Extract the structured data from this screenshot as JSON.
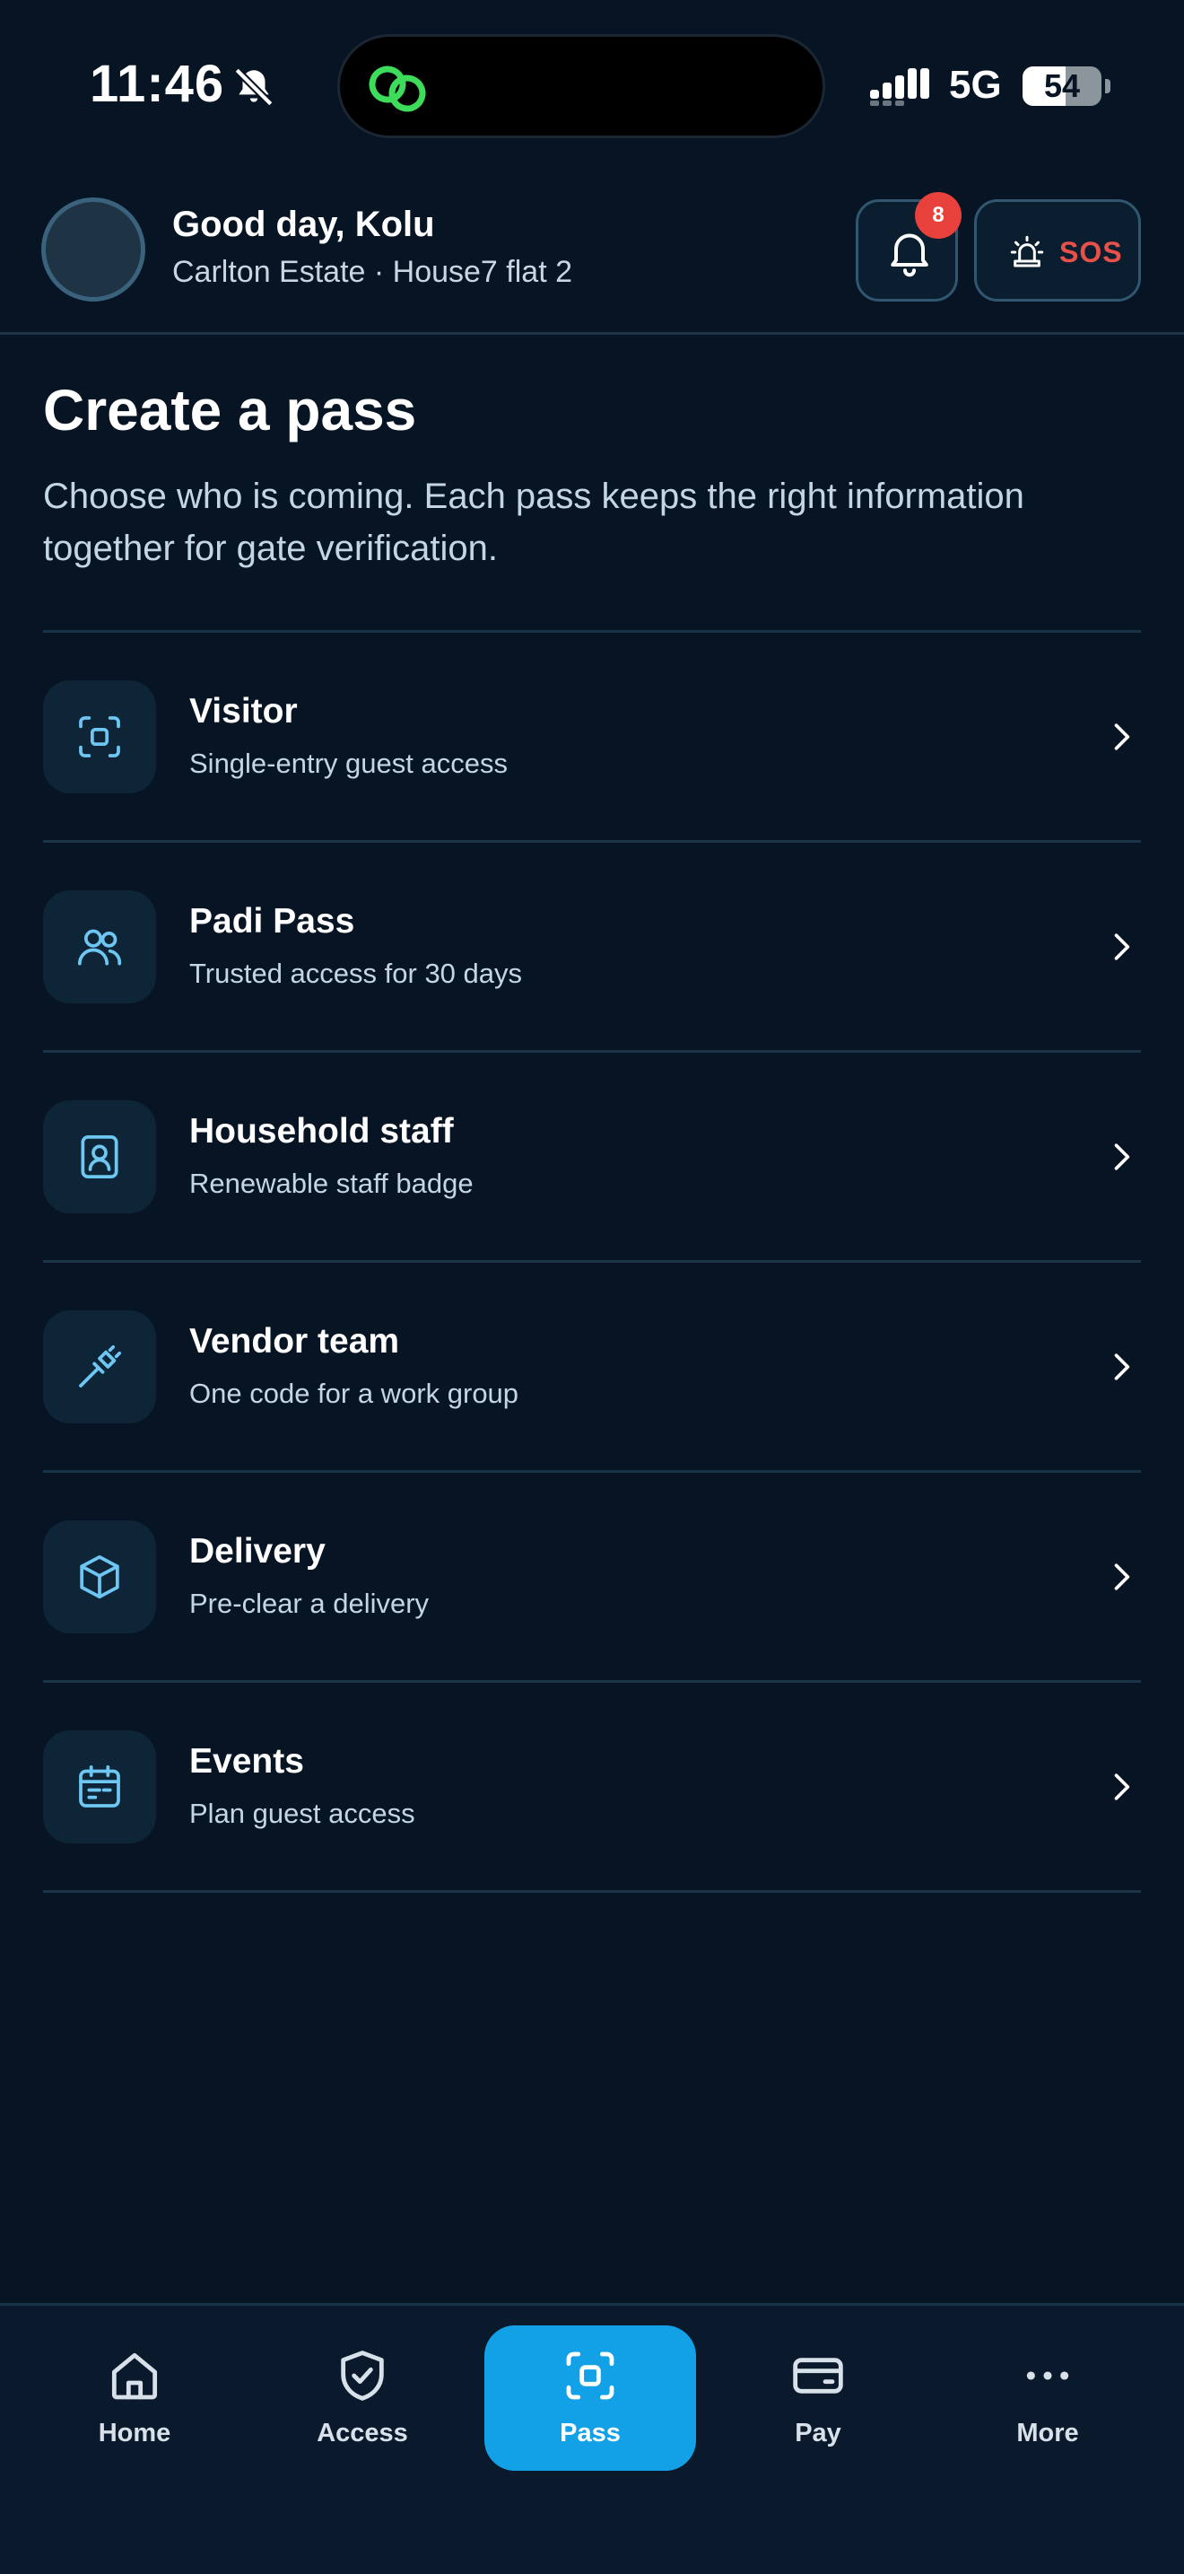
{
  "status_bar": {
    "time": "11:46",
    "network": "5G",
    "battery": "54",
    "battery_level": 0.54
  },
  "header": {
    "greeting": "Good day, Kolu",
    "location": "Carlton Estate · House7 flat 2",
    "notification_count": "8",
    "sos_label": "SOS"
  },
  "page": {
    "title": "Create a pass",
    "subtitle": "Choose who is coming. Each pass keeps the right information together for gate verification."
  },
  "pass_types": [
    {
      "title": "Visitor",
      "subtitle": "Single-entry guest access",
      "icon": "scan-icon"
    },
    {
      "title": "Padi Pass",
      "subtitle": "Trusted access for 30 days",
      "icon": "users-icon"
    },
    {
      "title": "Household staff",
      "subtitle": "Renewable staff badge",
      "icon": "id-badge-icon"
    },
    {
      "title": "Vendor team",
      "subtitle": "One code for a work group",
      "icon": "tool-icon"
    },
    {
      "title": "Delivery",
      "subtitle": "Pre-clear a delivery",
      "icon": "package-icon"
    },
    {
      "title": "Events",
      "subtitle": "Plan guest access",
      "icon": "calendar-icon"
    }
  ],
  "nav": {
    "home": "Home",
    "access": "Access",
    "pass": "Pass",
    "pay": "Pay",
    "more": "More",
    "active": "Pass"
  },
  "colors": {
    "background": "#061423",
    "accent": "#12a0e6",
    "icon": "#6ec6f2",
    "danger": "#e8413c"
  }
}
